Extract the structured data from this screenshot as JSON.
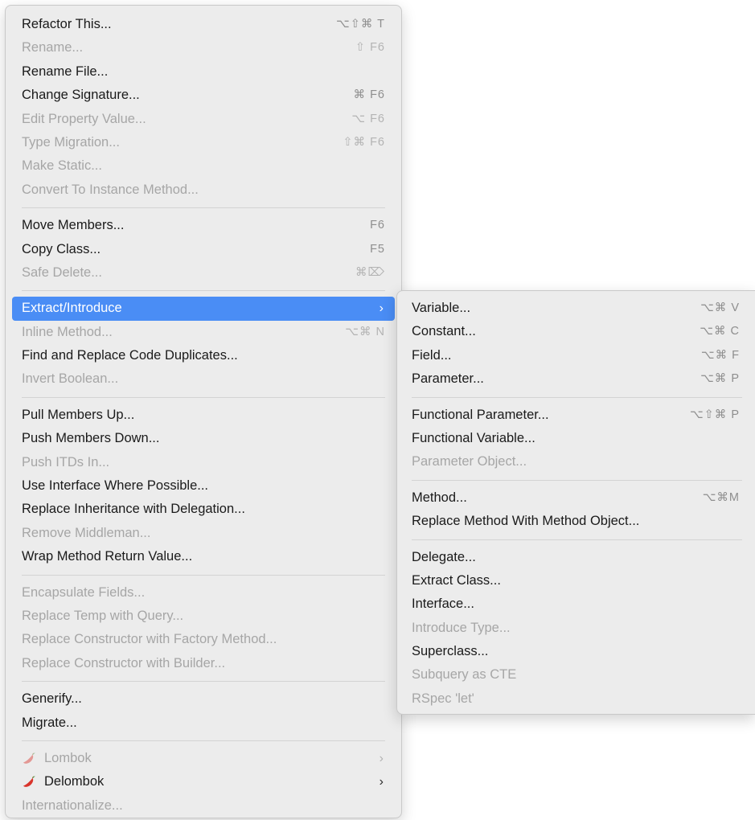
{
  "main_menu": {
    "groups": [
      [
        {
          "label": "Refactor This...",
          "shortcut": "⌥⇧⌘ T",
          "enabled": true
        },
        {
          "label": "Rename...",
          "shortcut": "⇧ F6",
          "enabled": false
        },
        {
          "label": "Rename File...",
          "shortcut": "",
          "enabled": true
        },
        {
          "label": "Change Signature...",
          "shortcut": "⌘ F6",
          "enabled": true
        },
        {
          "label": "Edit Property Value...",
          "shortcut": "⌥ F6",
          "enabled": false
        },
        {
          "label": "Type Migration...",
          "shortcut": "⇧⌘ F6",
          "enabled": false
        },
        {
          "label": "Make Static...",
          "shortcut": "",
          "enabled": false
        },
        {
          "label": "Convert To Instance Method...",
          "shortcut": "",
          "enabled": false
        }
      ],
      [
        {
          "label": "Move Members...",
          "shortcut": "F6",
          "enabled": true
        },
        {
          "label": "Copy Class...",
          "shortcut": "F5",
          "enabled": true
        },
        {
          "label": "Safe Delete...",
          "shortcut": "⌘⌦",
          "enabled": false
        }
      ],
      [
        {
          "label": "Extract/Introduce",
          "shortcut": "",
          "enabled": true,
          "selected": true,
          "submenu": true
        },
        {
          "label": "Inline Method...",
          "shortcut": "⌥⌘ N",
          "enabled": false
        },
        {
          "label": "Find and Replace Code Duplicates...",
          "shortcut": "",
          "enabled": true
        },
        {
          "label": "Invert Boolean...",
          "shortcut": "",
          "enabled": false
        }
      ],
      [
        {
          "label": "Pull Members Up...",
          "shortcut": "",
          "enabled": true
        },
        {
          "label": "Push Members Down...",
          "shortcut": "",
          "enabled": true
        },
        {
          "label": "Push ITDs In...",
          "shortcut": "",
          "enabled": false
        },
        {
          "label": "Use Interface Where Possible...",
          "shortcut": "",
          "enabled": true
        },
        {
          "label": "Replace Inheritance with Delegation...",
          "shortcut": "",
          "enabled": true
        },
        {
          "label": "Remove Middleman...",
          "shortcut": "",
          "enabled": false
        },
        {
          "label": "Wrap Method Return Value...",
          "shortcut": "",
          "enabled": true
        }
      ],
      [
        {
          "label": "Encapsulate Fields...",
          "shortcut": "",
          "enabled": false
        },
        {
          "label": "Replace Temp with Query...",
          "shortcut": "",
          "enabled": false
        },
        {
          "label": "Replace Constructor with Factory Method...",
          "shortcut": "",
          "enabled": false
        },
        {
          "label": "Replace Constructor with Builder...",
          "shortcut": "",
          "enabled": false
        }
      ],
      [
        {
          "label": "Generify...",
          "shortcut": "",
          "enabled": true
        },
        {
          "label": "Migrate...",
          "shortcut": "",
          "enabled": true
        }
      ],
      [
        {
          "label": "Lombok",
          "shortcut": "",
          "enabled": false,
          "submenu": true,
          "icon": "chili-pepper-icon"
        },
        {
          "label": "Delombok",
          "shortcut": "",
          "enabled": true,
          "submenu": true,
          "icon": "chili-pepper-icon"
        },
        {
          "label": "Internationalize...",
          "shortcut": "",
          "enabled": false
        }
      ]
    ]
  },
  "sub_menu": {
    "groups": [
      [
        {
          "label": "Variable...",
          "shortcut": "⌥⌘ V",
          "enabled": true
        },
        {
          "label": "Constant...",
          "shortcut": "⌥⌘ C",
          "enabled": true
        },
        {
          "label": "Field...",
          "shortcut": "⌥⌘ F",
          "enabled": true
        },
        {
          "label": "Parameter...",
          "shortcut": "⌥⌘ P",
          "enabled": true
        }
      ],
      [
        {
          "label": "Functional Parameter...",
          "shortcut": "⌥⇧⌘ P",
          "enabled": true
        },
        {
          "label": "Functional Variable...",
          "shortcut": "",
          "enabled": true
        },
        {
          "label": "Parameter Object...",
          "shortcut": "",
          "enabled": false
        }
      ],
      [
        {
          "label": "Method...",
          "shortcut": "⌥⌘M",
          "enabled": true
        },
        {
          "label": "Replace Method With Method Object...",
          "shortcut": "",
          "enabled": true
        }
      ],
      [
        {
          "label": "Delegate...",
          "shortcut": "",
          "enabled": true
        },
        {
          "label": "Extract Class...",
          "shortcut": "",
          "enabled": true
        },
        {
          "label": "Interface...",
          "shortcut": "",
          "enabled": true
        },
        {
          "label": "Introduce Type...",
          "shortcut": "",
          "enabled": false
        },
        {
          "label": "Superclass...",
          "shortcut": "",
          "enabled": true
        },
        {
          "label": "Subquery as CTE",
          "shortcut": "",
          "enabled": false
        },
        {
          "label": "RSpec 'let'",
          "shortcut": "",
          "enabled": false
        }
      ]
    ]
  },
  "submenu_arrow": "›",
  "colors": {
    "selection": "#4a8df5",
    "menu_bg": "#ececec",
    "disabled_text": "#a6a6a6"
  }
}
